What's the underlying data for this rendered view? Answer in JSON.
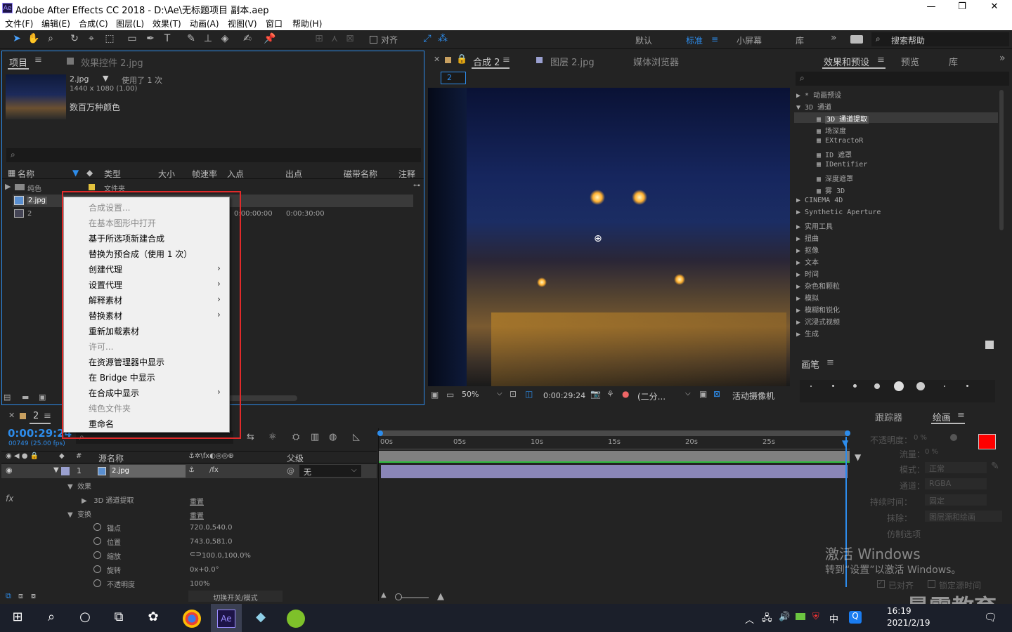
{
  "title_bar": {
    "app_title": "Adobe After Effects CC 2018 - D:\\Ae\\无标题项目 副本.aep"
  },
  "menu": [
    "文件(F)",
    "编辑(E)",
    "合成(C)",
    "图层(L)",
    "效果(T)",
    "动画(A)",
    "视图(V)",
    "窗口",
    "帮助(H)"
  ],
  "toolbar": {
    "align_label": "对齐",
    "workspaces": [
      "默认",
      "标准",
      "小屏幕",
      "库"
    ],
    "search_help": "搜索帮助"
  },
  "project_panel": {
    "tab_project": "项目",
    "tab_effects_controls": "效果控件 2.jpg",
    "footage_name": "2.jpg",
    "used_text": "使用了 1 次",
    "footage_dims": "1440 x 1080 (1.00)",
    "footage_colors": "数百万种颜色",
    "columns": [
      "名称",
      "类型",
      "大小",
      "帧速率",
      "入点",
      "出点",
      "磁带名称",
      "注释"
    ],
    "rows": [
      {
        "name": "纯色",
        "type": "文件夹",
        "in": "",
        "out": ""
      },
      {
        "name": "2.jpg",
        "type": "",
        "in": "",
        "out": ""
      },
      {
        "name": "2",
        "type": "",
        "in": "0:00:00:00",
        "out": "0:00:30:00"
      }
    ]
  },
  "context_menu": {
    "items": [
      {
        "label": "合成设置...",
        "disabled": true,
        "submenu": false
      },
      {
        "label": "在基本图形中打开",
        "disabled": true,
        "submenu": false
      },
      {
        "label": "基于所选项新建合成",
        "disabled": false,
        "submenu": false
      },
      {
        "label": "替换为预合成（使用 1 次）",
        "disabled": false,
        "submenu": false
      },
      {
        "label": "创建代理",
        "disabled": false,
        "submenu": true
      },
      {
        "label": "设置代理",
        "disabled": false,
        "submenu": true
      },
      {
        "label": "解释素材",
        "disabled": false,
        "submenu": true
      },
      {
        "label": "替换素材",
        "disabled": false,
        "submenu": true
      },
      {
        "label": "重新加载素材",
        "disabled": false,
        "submenu": false
      },
      {
        "label": "许可...",
        "disabled": true,
        "submenu": false
      },
      {
        "label": "在资源管理器中显示",
        "disabled": false,
        "submenu": false
      },
      {
        "label": "在 Bridge 中显示",
        "disabled": false,
        "submenu": false
      },
      {
        "label": "在合成中显示",
        "disabled": false,
        "submenu": true
      },
      {
        "label": "纯色文件夹",
        "disabled": true,
        "submenu": false
      },
      {
        "label": "重命名",
        "disabled": false,
        "submenu": false
      }
    ]
  },
  "comp_panel": {
    "tab_comp": "合成 2",
    "tab_layer": "图层 2.jpg",
    "tab_media": "媒体浏览器",
    "comp_chip": "2",
    "zoom": "50%",
    "timecode": "0:00:29:24",
    "resolution": "(二分...",
    "camera": "活动摄像机"
  },
  "effects_panel": {
    "tab_effects": "效果和预设",
    "tab_preview": "预览",
    "tab_library": "库",
    "items": [
      {
        "label": "* 动画预设",
        "level": 0,
        "open": false
      },
      {
        "label": "3D 通道",
        "level": 0,
        "open": true
      },
      {
        "label": "3D 通道提取",
        "level": 1,
        "selected": true
      },
      {
        "label": "场深度",
        "level": 1
      },
      {
        "label": "EXtractoR",
        "level": 1
      },
      {
        "label": "ID 遮罩",
        "level": 1
      },
      {
        "label": "IDentifier",
        "level": 1
      },
      {
        "label": "深度遮罩",
        "level": 1
      },
      {
        "label": "雾 3D",
        "level": 1
      },
      {
        "label": "CINEMA 4D",
        "level": 0
      },
      {
        "label": "Synthetic Aperture",
        "level": 0
      },
      {
        "label": "实用工具",
        "level": 0
      },
      {
        "label": "扭曲",
        "level": 0
      },
      {
        "label": "抠像",
        "level": 0
      },
      {
        "label": "文本",
        "level": 0
      },
      {
        "label": "时间",
        "level": 0
      },
      {
        "label": "杂色和颗粒",
        "level": 0
      },
      {
        "label": "模拟",
        "level": 0
      },
      {
        "label": "模糊和锐化",
        "level": 0
      },
      {
        "label": "沉浸式视频",
        "level": 0
      },
      {
        "label": "生成",
        "level": 0
      }
    ],
    "brush_title": "画笔"
  },
  "timeline": {
    "comp_tab": "2",
    "timecode": "0:00:29:24",
    "frames": "00749 (25.00 fps)",
    "source_name_col": "源名称",
    "parent_col": "父级",
    "ruler": [
      "00s",
      "05s",
      "10s",
      "15s",
      "20s",
      "25s"
    ],
    "layer_num": "1",
    "layer_name": "2.jpg",
    "parent_value": "无",
    "effects_label": "效果",
    "effect_name": "3D 通道提取",
    "reset": "重置",
    "transform_label": "变换",
    "props": [
      {
        "name": "锚点",
        "value": "720.0,540.0"
      },
      {
        "name": "位置",
        "value": "743.0,581.0"
      },
      {
        "name": "缩放",
        "value": "100.0,100.0%"
      },
      {
        "name": "旋转",
        "value": "0x+0.0°"
      },
      {
        "name": "不透明度",
        "value": "100%"
      }
    ],
    "switch_mode": "切换开关/模式"
  },
  "paint_panel": {
    "tab_tracker": "跟踪器",
    "tab_paint": "绘画",
    "opacity_label": "不透明度：",
    "opacity_value": "0 %",
    "flow_label": "流量：",
    "flow_value": "0 %",
    "mode_label": "模式：",
    "mode_value": "正常",
    "channel_label": "通道：",
    "channel_value": "RGBA",
    "duration_label": "持续时间：",
    "duration_value": "固定",
    "erase_label": "抹除：",
    "erase_value": "图层源和绘画",
    "clone_label": "仿制选项",
    "aligned": "已对齐",
    "lock_source": "锁定源时间",
    "fg_color": "#ff0000"
  },
  "watermark": {
    "activate_title": "激活 Windows",
    "activate_sub": "转到“设置”以激活 Windows。",
    "brand": "最需教育"
  },
  "taskbar": {
    "time": "16:19",
    "date": "2021/2/19",
    "ime": "中"
  }
}
